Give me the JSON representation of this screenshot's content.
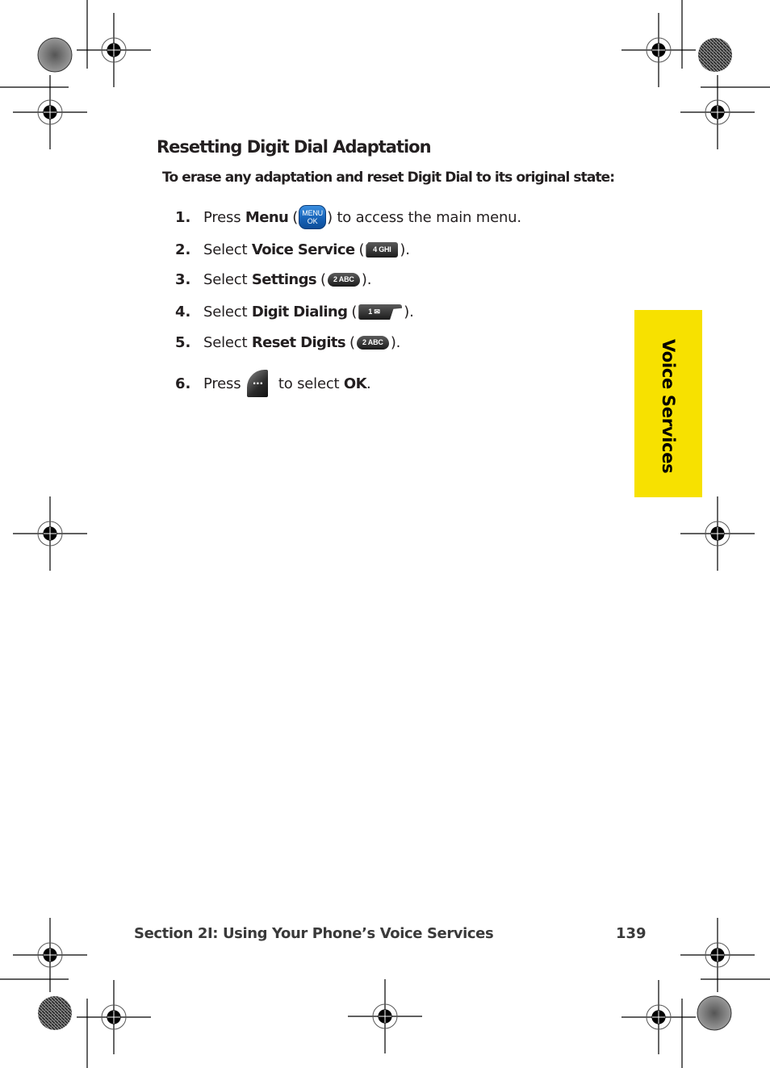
{
  "heading": "Resetting Digit Dial Adaptation",
  "intro": "To erase any adaptation and reset Digit Dial to its original state:",
  "steps": [
    {
      "num": "1.",
      "pre": "Press ",
      "bold": "Menu",
      "key_icon": "menu-ok-key",
      "key_lines": [
        "MENU",
        "OK"
      ],
      "post": " to access the main menu."
    },
    {
      "num": "2.",
      "pre": "Select ",
      "bold": "Voice Service",
      "key_icon": "key-4-ghi",
      "key_label": "4 GHI",
      "post": "."
    },
    {
      "num": "3.",
      "pre": "Select ",
      "bold": "Settings",
      "key_icon": "key-2-abc",
      "key_label": "2 ABC",
      "post": "."
    },
    {
      "num": "4.",
      "pre": "Select ",
      "bold": "Digit Dialing",
      "key_icon": "key-1-voicemail",
      "key_label": "1 ✉",
      "post": "."
    },
    {
      "num": "5.",
      "pre": "Select ",
      "bold": "Reset Digits",
      "key_icon": "key-2-abc",
      "key_label": "2 ABC",
      "post": "."
    },
    {
      "num": "6.",
      "pre": "Press ",
      "key_icon": "right-softkey",
      "key_label": "···",
      "mid": " to select ",
      "bold": "OK",
      "post": "."
    }
  ],
  "side_tab": {
    "label": "Voice Services",
    "color": "#f7e100"
  },
  "footer": {
    "section": "Section 2I: Using Your Phone’s Voice Services",
    "page_number": "139"
  },
  "paren_open": "(",
  "paren_close": ")"
}
